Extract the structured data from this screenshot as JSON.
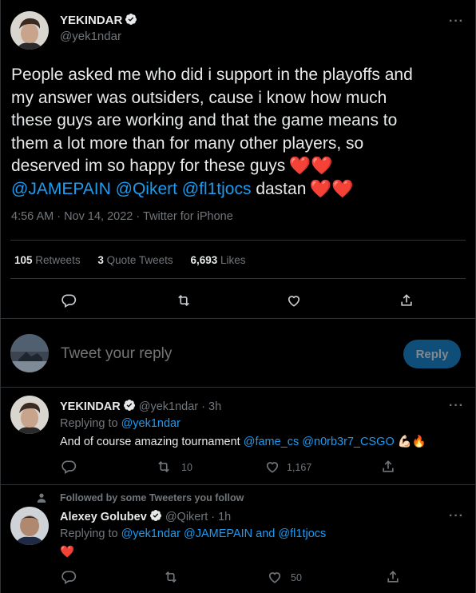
{
  "main_tweet": {
    "name": "YEKINDAR",
    "handle": "@yek1ndar",
    "text_line1": "People asked me who did i support in the playoffs and",
    "text_line2": "my answer was outsiders, cause i know how much",
    "text_line3": "these guys are working and that the game means to",
    "text_line4": "them a lot more than for many other players, so",
    "text_line5": "deserved im so happy for these guys",
    "hearts": "❤️❤️",
    "mention1": "@JAMEPAIN",
    "mention2": "@Qikert",
    "mention3": "@fl1tjocs",
    "text_tail": "dastan",
    "timestamp": "4:56 AM · Nov 14, 2022 · Twitter for iPhone",
    "more": "···"
  },
  "stats": {
    "retweets_count": "105",
    "retweets_label": "Retweets",
    "quotes_count": "3",
    "quotes_label": "Quote Tweets",
    "likes_count": "6,693",
    "likes_label": "Likes"
  },
  "reply_box": {
    "placeholder": "Tweet your reply",
    "button_label": "Reply"
  },
  "replies": [
    {
      "name": "YEKINDAR",
      "handle_time": "@yek1ndar · 3h",
      "replying_prefix": "Replying to",
      "replying_to": "@yek1ndar",
      "text": "And of course amazing tournament",
      "mention_a": "@fame_cs",
      "mention_b": "@n0rb3r7_CSGO",
      "emoji": "💪🏻🔥",
      "retweets": "10",
      "likes": "1,167",
      "more": "···"
    },
    {
      "social_context": "Followed by some Tweeters you follow",
      "name": "Alexey Golubev",
      "handle_time": "@Qikert · 1h",
      "replying_prefix": "Replying to",
      "replying_to": "@yek1ndar @JAMEPAIN",
      "replying_and": "and",
      "replying_last": "@fl1tjocs",
      "text": "❤️",
      "likes": "50",
      "more": "···"
    }
  ],
  "colors": {
    "background": "#000000",
    "accent": "#1d9bf0",
    "muted": "#71767b",
    "heart": "#e0245e"
  }
}
